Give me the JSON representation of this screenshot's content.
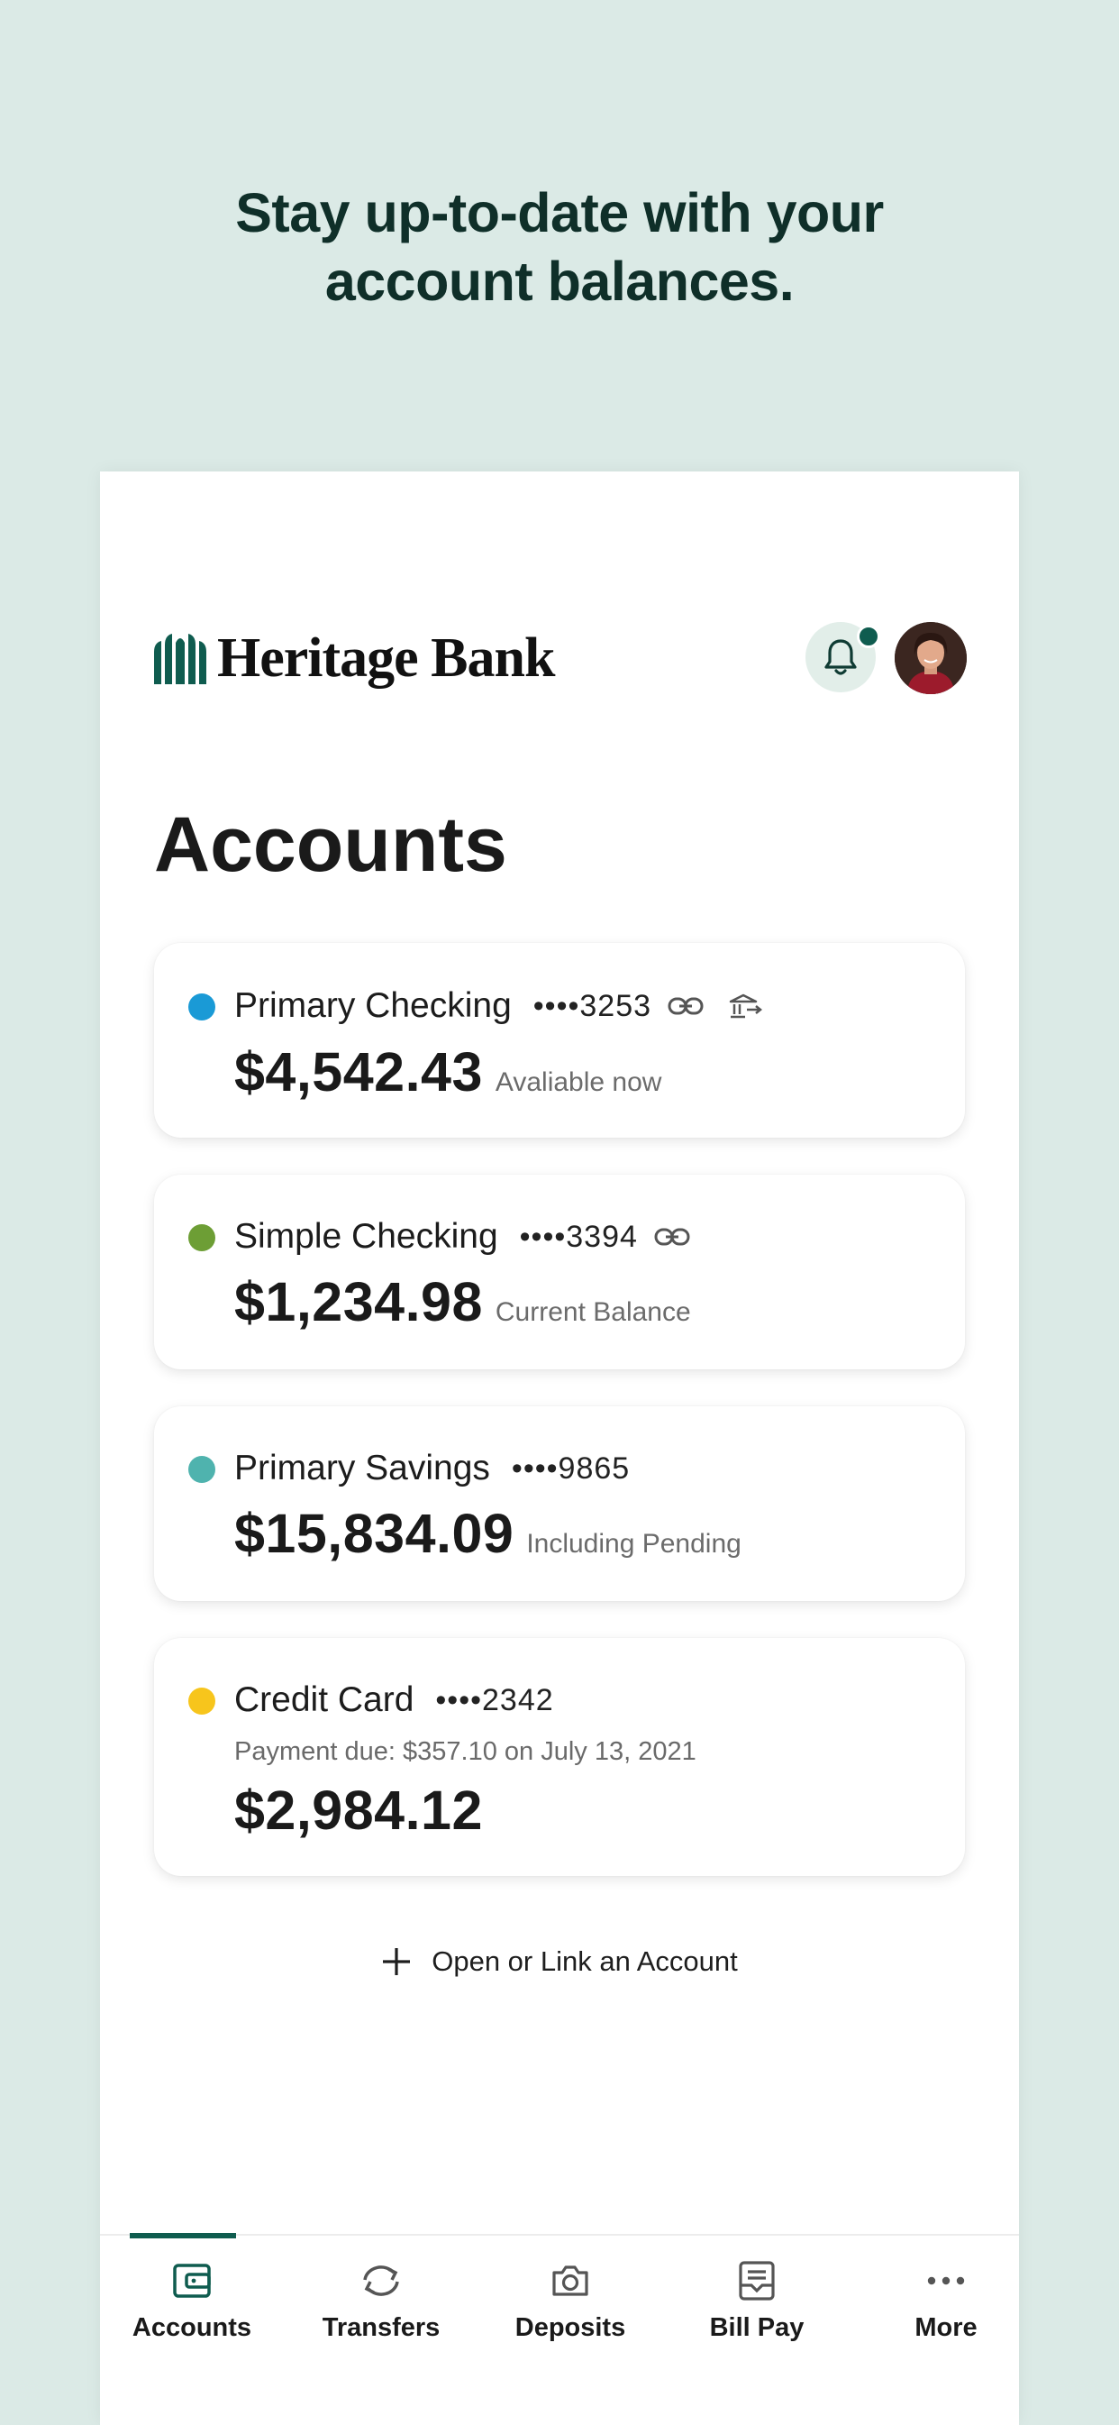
{
  "promo": {
    "line1": "Stay up-to-date with your",
    "line2": "account balances."
  },
  "header": {
    "bank_name": "Heritage Bank",
    "logo_icon": "heritage-columns-logo",
    "notification_icon": "bell-icon",
    "has_unread_notification": true
  },
  "page_title": "Accounts",
  "accounts": [
    {
      "name": "Primary Checking",
      "mask": "••••3253",
      "balance": "$4,542.43",
      "balance_label": "Avaliable now",
      "dot_color": "#1a9ad6",
      "icons": [
        "link-icon",
        "bank-transfer-icon"
      ]
    },
    {
      "name": "Simple Checking",
      "mask": "••••3394",
      "balance": "$1,234.98",
      "balance_label": "Current Balance",
      "dot_color": "#6d9e35",
      "icons": [
        "link-icon"
      ]
    },
    {
      "name": "Primary Savings",
      "mask": "••••9865",
      "balance": "$15,834.09",
      "balance_label": "Including Pending",
      "dot_color": "#4fb3ae",
      "icons": []
    },
    {
      "name": "Credit Card",
      "mask": "••••2342",
      "payment_due": "Payment due: $357.10 on July 13, 2021",
      "balance": "$2,984.12",
      "dot_color": "#f7c51c",
      "icons": []
    }
  ],
  "open_link_label": "Open or Link an Account",
  "nav": {
    "active": "Accounts",
    "items": [
      {
        "label": "Accounts",
        "icon": "wallet-icon"
      },
      {
        "label": "Transfers",
        "icon": "transfer-arrows-icon"
      },
      {
        "label": "Deposits",
        "icon": "camera-icon"
      },
      {
        "label": "Bill Pay",
        "icon": "bill-icon"
      },
      {
        "label": "More",
        "icon": "more-dots-icon"
      }
    ]
  },
  "colors": {
    "background": "#dbeae6",
    "brand": "#0f5c4f",
    "headline": "#0f2f29"
  }
}
